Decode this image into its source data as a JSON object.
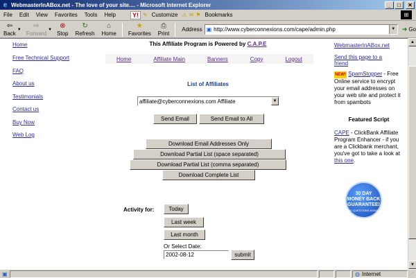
{
  "window": {
    "title": "WebmasterInABox.net - The love of your site.... - Microsoft Internet Explorer",
    "buttons": {
      "minimize": "_",
      "maximize": "□",
      "close": "✕"
    }
  },
  "menu": [
    "File",
    "Edit",
    "View",
    "Favorites",
    "Tools",
    "Help"
  ],
  "yahoo_bar": {
    "logo": "Y!",
    "customize": "Customize",
    "bookmarks": "Bookmarks"
  },
  "toolbar": {
    "back": "Back",
    "forward": "Forward",
    "stop": "Stop",
    "refresh": "Refresh",
    "home": "Home",
    "favorites": "Favorites",
    "print": "Print"
  },
  "address": {
    "label": "Address",
    "url": "http://www.cyberconnexions.com/cape/admin.php",
    "go": "Go"
  },
  "left_nav": [
    "Home",
    "Free Technical Support",
    "FAQ",
    "About us",
    "Testimonials",
    "Contact us",
    "Buy Now",
    "Web Log"
  ],
  "header": {
    "powered_text": "This Affiliate Program is Powered by ",
    "powered_link": "C.A.P.E"
  },
  "top_nav": [
    "Home",
    "Affiliate Main",
    "Banners",
    "Copy",
    "Logout"
  ],
  "affiliates": {
    "title": "List of Affiliates",
    "selected": "affiliate@cyberconnexions.com Affiliate",
    "send_email": "Send Email",
    "send_email_all": "Send Email to All"
  },
  "downloads": {
    "email_only": "Download Email Addresses Only",
    "partial_space": "Download Partial List (space separated)",
    "partial_comma": "Download Partial List (comma separated)",
    "complete": "Download Complete List"
  },
  "activity": {
    "label": "Activity for:",
    "today": "Today",
    "last_week": "Last week",
    "last_month": "Last month",
    "or_select": "Or Select Date:",
    "date_value": "2002-08-12",
    "submit": "submit"
  },
  "right_col": {
    "site_link": "WebmasterInABox.net",
    "send_page": "Send this page to a",
    "send_page2": "friend",
    "new_badge": "NEW!",
    "spamstopper": "SpamStopper",
    "spam_text": " - Free Online service to encrypt your email addresses on your web site and protect it from spambots",
    "featured": "Featured Script",
    "cape_link": "CAPE",
    "cape_text": " - ClickBank Affiliate Program Enhancer - if you are a Clickbank merchant, you've got to take a look at ",
    "this_one": "this one",
    "period": ".",
    "guarantee": [
      "30 DAY",
      "MONEY BACK",
      "GUARANTEE!"
    ],
    "guarantee_small": "NO QUESTIONS ASKED"
  },
  "status": {
    "zone": "Internet"
  }
}
